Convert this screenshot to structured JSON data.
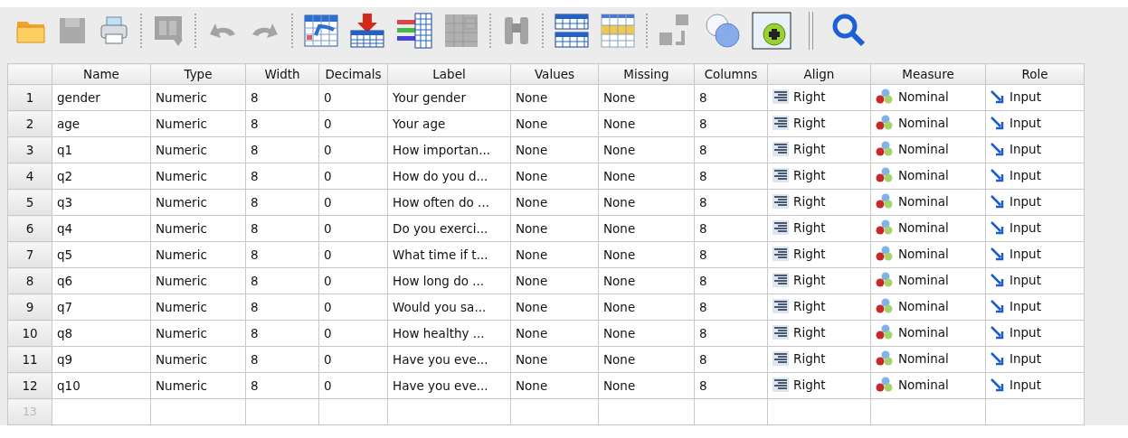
{
  "table": {
    "columns": [
      {
        "label": "Name",
        "kind": "text"
      },
      {
        "label": "Type",
        "kind": "text"
      },
      {
        "label": "Width",
        "kind": "text"
      },
      {
        "label": "Decimals",
        "kind": "text"
      },
      {
        "label": "Label",
        "kind": "text"
      },
      {
        "label": "Values",
        "kind": "text"
      },
      {
        "label": "Missing",
        "kind": "text"
      },
      {
        "label": "Columns",
        "kind": "text"
      },
      {
        "label": "Align",
        "kind": "align"
      },
      {
        "label": "Measure",
        "kind": "measure"
      },
      {
        "label": "Role",
        "kind": "role"
      }
    ],
    "rows": [
      {
        "number": "1",
        "cells": [
          "gender",
          "Numeric",
          "8",
          "0",
          "Your gender",
          "None",
          "None",
          "8",
          "Right",
          "Nominal",
          "Input"
        ]
      },
      {
        "number": "2",
        "cells": [
          "age",
          "Numeric",
          "8",
          "0",
          "Your age",
          "None",
          "None",
          "8",
          "Right",
          "Nominal",
          "Input"
        ]
      },
      {
        "number": "3",
        "cells": [
          "q1",
          "Numeric",
          "8",
          "0",
          "How importan...",
          "None",
          "None",
          "8",
          "Right",
          "Nominal",
          "Input"
        ]
      },
      {
        "number": "4",
        "cells": [
          "q2",
          "Numeric",
          "8",
          "0",
          "How do you d...",
          "None",
          "None",
          "8",
          "Right",
          "Nominal",
          "Input"
        ]
      },
      {
        "number": "5",
        "cells": [
          "q3",
          "Numeric",
          "8",
          "0",
          "How often do ...",
          "None",
          "None",
          "8",
          "Right",
          "Nominal",
          "Input"
        ]
      },
      {
        "number": "6",
        "cells": [
          "q4",
          "Numeric",
          "8",
          "0",
          "Do you exerci...",
          "None",
          "None",
          "8",
          "Right",
          "Nominal",
          "Input"
        ]
      },
      {
        "number": "7",
        "cells": [
          "q5",
          "Numeric",
          "8",
          "0",
          "What time if t...",
          "None",
          "None",
          "8",
          "Right",
          "Nominal",
          "Input"
        ]
      },
      {
        "number": "8",
        "cells": [
          "q6",
          "Numeric",
          "8",
          "0",
          "How long do ...",
          "None",
          "None",
          "8",
          "Right",
          "Nominal",
          "Input"
        ]
      },
      {
        "number": "9",
        "cells": [
          "q7",
          "Numeric",
          "8",
          "0",
          "Would you sa...",
          "None",
          "None",
          "8",
          "Right",
          "Nominal",
          "Input"
        ]
      },
      {
        "number": "10",
        "cells": [
          "q8",
          "Numeric",
          "8",
          "0",
          "How healthy ...",
          "None",
          "None",
          "8",
          "Right",
          "Nominal",
          "Input"
        ]
      },
      {
        "number": "11",
        "cells": [
          "q9",
          "Numeric",
          "8",
          "0",
          "Have you eve...",
          "None",
          "None",
          "8",
          "Right",
          "Nominal",
          "Input"
        ]
      },
      {
        "number": "12",
        "cells": [
          "q10",
          "Numeric",
          "8",
          "0",
          "Have you eve...",
          "None",
          "None",
          "8",
          "Right",
          "Nominal",
          "Input"
        ]
      }
    ],
    "empty_row_number": "13"
  }
}
